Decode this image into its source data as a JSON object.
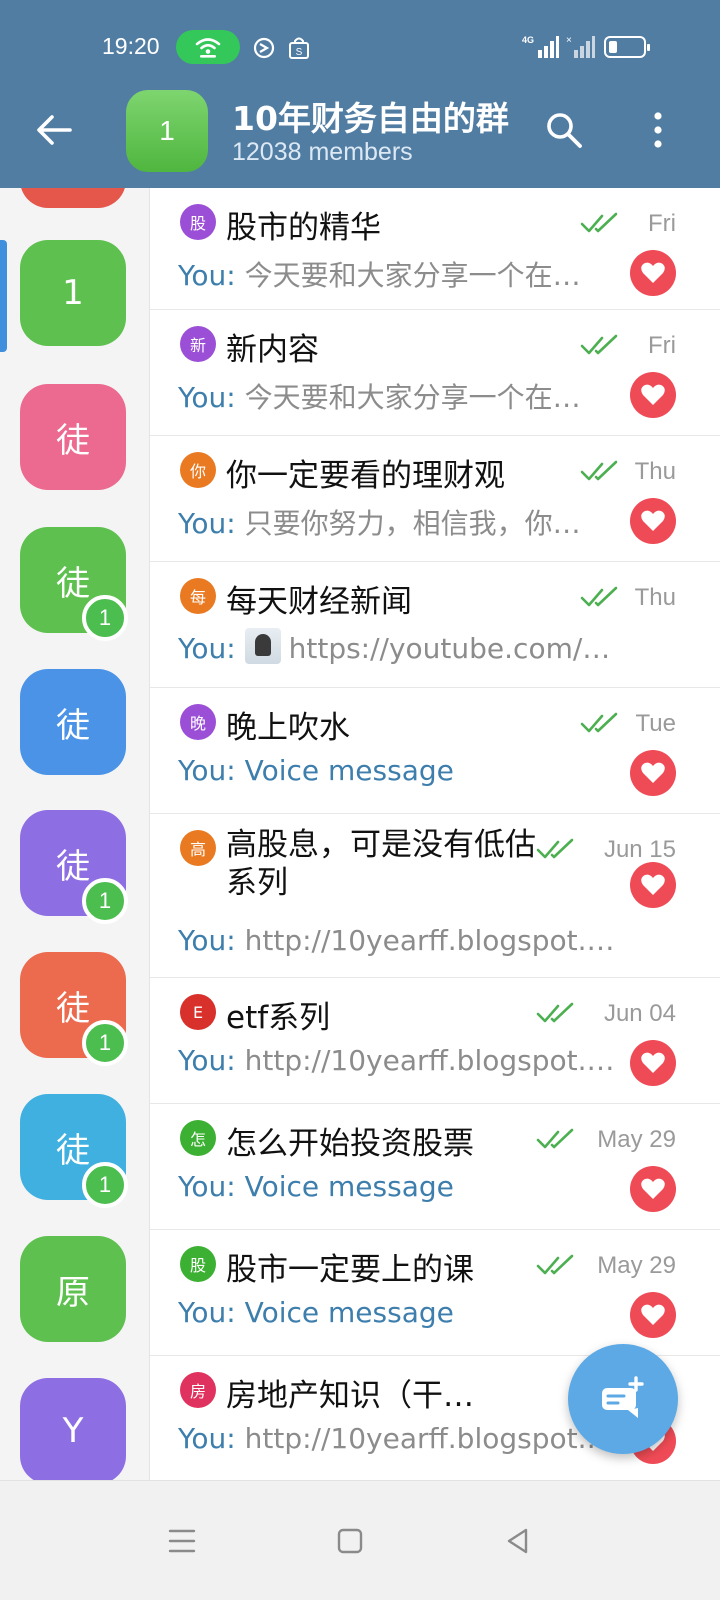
{
  "status_bar": {
    "time": "19:20",
    "network": "4G"
  },
  "header": {
    "avatar_letter": "1",
    "title": "10年财务自由的群",
    "subtitle": "12038 members"
  },
  "sidebar": {
    "folders": [
      {
        "label": "1",
        "color": "#5ec04e",
        "badge": "",
        "selected": true
      },
      {
        "label": "徒",
        "color": "#ec6a8f",
        "badge": ""
      },
      {
        "label": "徒",
        "color": "#5ec04e",
        "badge": "1"
      },
      {
        "label": "徒",
        "color": "#4a93e6",
        "badge": ""
      },
      {
        "label": "徒",
        "color": "#8e6fe3",
        "badge": "1"
      },
      {
        "label": "徒",
        "color": "#ec6a4e",
        "badge": "1"
      },
      {
        "label": "徒",
        "color": "#3fb0e0",
        "badge": "1"
      },
      {
        "label": "原",
        "color": "#5ec04e",
        "badge": ""
      },
      {
        "label": "Y",
        "color": "#8e6fe3",
        "badge": ""
      }
    ]
  },
  "chats": [
    {
      "icon": "股",
      "icon_color": "#9b4fd6",
      "title": "股市的精华",
      "date": "Fri",
      "prefix": "You: ",
      "preview": "今天要和大家分享一个在…",
      "kind": "text"
    },
    {
      "icon": "新",
      "icon_color": "#9b4fd6",
      "title": "新内容",
      "date": "Fri",
      "prefix": "You: ",
      "preview": "今天要和大家分享一个在…",
      "kind": "text"
    },
    {
      "icon": "你",
      "icon_color": "#ea7a22",
      "title": "你一定要看的理财观",
      "date": "Thu",
      "prefix": "You: ",
      "preview": "只要你努力，相信我，你…",
      "kind": "text"
    },
    {
      "icon": "每",
      "icon_color": "#ea7a22",
      "title": "每天财经新闻",
      "date": "Thu",
      "prefix": "You: ",
      "preview": "https://youtube.com/sho…",
      "kind": "link"
    },
    {
      "icon": "晚",
      "icon_color": "#9b4fd6",
      "title": "晚上吹水",
      "date": "Tue",
      "prefix": "You: ",
      "preview": "Voice message",
      "kind": "voice"
    },
    {
      "icon": "高",
      "icon_color": "#ea7a22",
      "title": "高股息，可是没有低估系列",
      "date": "Jun 15",
      "prefix": "You: ",
      "preview": "http://10yearff.blogspot.…",
      "kind": "text"
    },
    {
      "icon": "E",
      "icon_color": "#d8302a",
      "title": "etf系列",
      "date": "Jun 04",
      "prefix": "You: ",
      "preview": "http://10yearff.blogspot.…",
      "kind": "text"
    },
    {
      "icon": "怎",
      "icon_color": "#3cb032",
      "title": "怎么开始投资股票",
      "date": "May 29",
      "prefix": "You: ",
      "preview": "Voice message",
      "kind": "voice"
    },
    {
      "icon": "股",
      "icon_color": "#3cb032",
      "title": "股市一定要上的课",
      "date": "May 29",
      "prefix": "You: ",
      "preview": "Voice message",
      "kind": "voice"
    },
    {
      "icon": "房",
      "icon_color": "#e0325f",
      "title": "房地产知识（干…",
      "date": "",
      "prefix": "You: ",
      "preview": "http://10yearff.blogspot.…",
      "kind": "text"
    }
  ],
  "colors": {
    "header_bg": "#527da3",
    "accent": "#3d7ead",
    "check": "#4caf50",
    "heart": "#ef4b56",
    "fab": "#5ca9e6"
  },
  "icons": {
    "back": "arrow-left-icon",
    "search": "search-icon",
    "more": "more-vertical-icon",
    "fab": "new-message-icon"
  }
}
